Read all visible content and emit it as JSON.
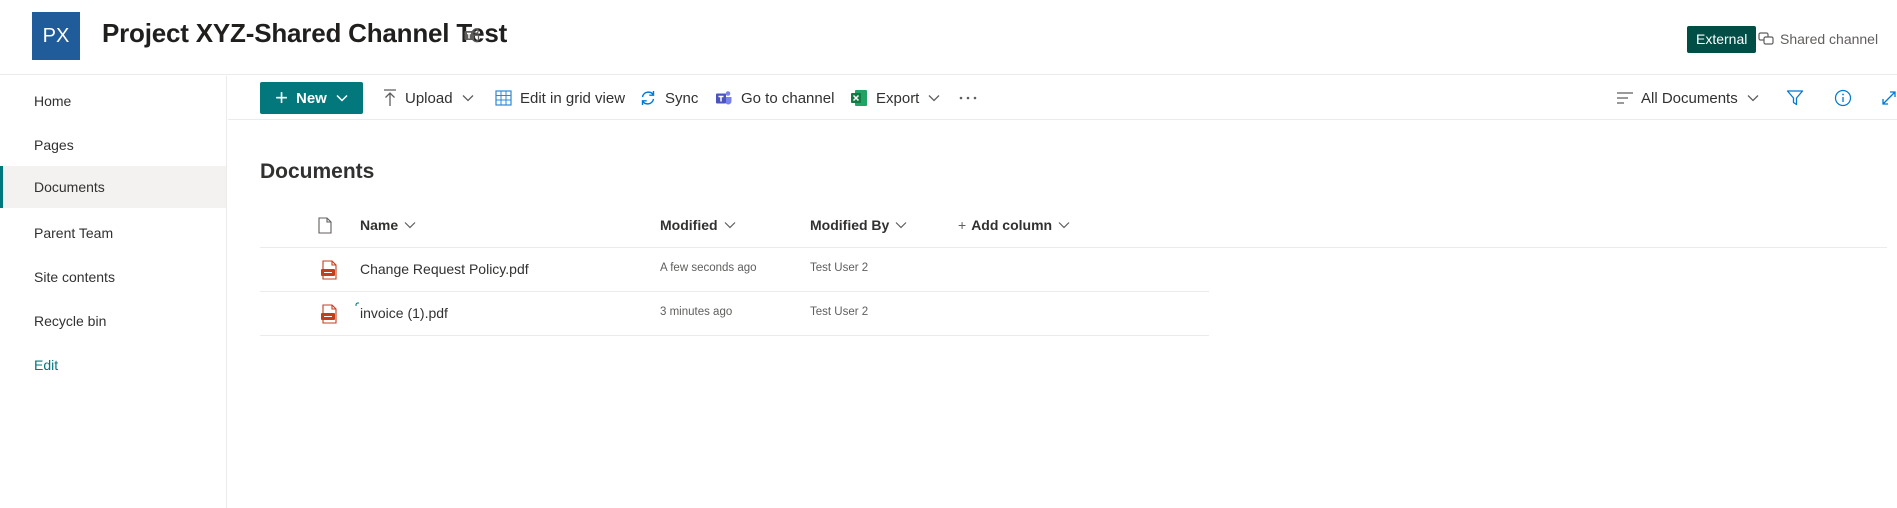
{
  "site": {
    "logo_initials": "PX",
    "title": "Project XYZ-Shared Channel Test",
    "external_label": "External",
    "shared_channel_label": "Shared channel"
  },
  "nav": {
    "items": [
      {
        "label": "Home",
        "selected": false
      },
      {
        "label": "Pages",
        "selected": false
      },
      {
        "label": "Documents",
        "selected": true
      },
      {
        "label": "Parent Team",
        "selected": false
      },
      {
        "label": "Site contents",
        "selected": false
      },
      {
        "label": "Recycle bin",
        "selected": false
      }
    ],
    "edit_label": "Edit"
  },
  "commandbar": {
    "new_label": "New",
    "upload_label": "Upload",
    "grid_label": "Edit in grid view",
    "sync_label": "Sync",
    "channel_label": "Go to channel",
    "export_label": "Export",
    "view_label": "All Documents"
  },
  "library": {
    "title": "Documents",
    "columns": {
      "name": "Name",
      "modified": "Modified",
      "modified_by": "Modified By",
      "add_column": "Add column"
    },
    "rows": [
      {
        "name": "Change Request Policy.pdf",
        "modified": "A few seconds ago",
        "modified_by": "Test User 2",
        "is_new": false
      },
      {
        "name": "invoice (1).pdf",
        "modified": "3 minutes ago",
        "modified_by": "Test User 2",
        "is_new": true
      }
    ]
  },
  "colors": {
    "accent": "#03787c",
    "logo_bg": "#1f5c99",
    "external_badge": "#004e46",
    "pdf_icon": "#c43e1c"
  },
  "icons": [
    "teams-icon",
    "shared-channel-icon",
    "upload-icon",
    "grid-icon",
    "sync-icon",
    "teams-channel-icon",
    "excel-icon",
    "more-icon",
    "view-lines-icon",
    "filter-icon",
    "info-icon",
    "expand-icon",
    "file-type-icon",
    "pdf-icon"
  ]
}
